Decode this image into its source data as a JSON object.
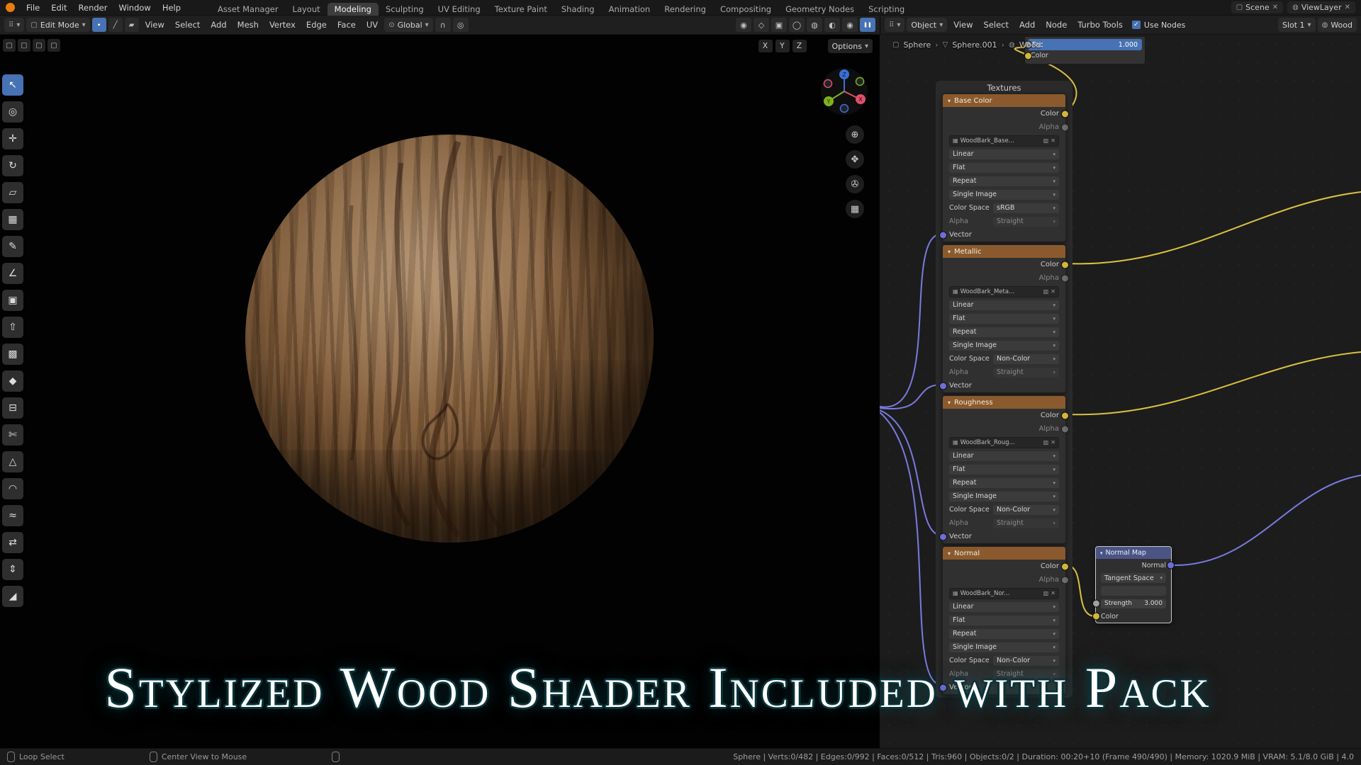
{
  "icons": {
    "chevron": "▾",
    "check": "✓",
    "close": "✕",
    "sep": "›",
    "editor_type": "⠿",
    "image": "▦",
    "fake_user": "▥",
    "zoom": "⊕",
    "pan": "✥",
    "camera": "✇",
    "grid_floor": "▦",
    "wireframe": "◯",
    "solid": "◍",
    "material_preview": "◐",
    "rendered": "◉",
    "pause": "❚❚",
    "globe": "⊙",
    "magnet": "∩",
    "proportional": "◎",
    "vertex_mode": "∙",
    "edge_mode": "╱",
    "face_mode": "▰",
    "cube": "▢",
    "mesh": "▽",
    "material": "◍",
    "widget": "▢",
    "visibility": "◉",
    "overlays": "◇",
    "xray": "▣"
  },
  "topbar": {
    "menus": [
      "File",
      "Edit",
      "Render",
      "Window",
      "Help"
    ],
    "workspaces": [
      "Asset Manager",
      "Layout",
      "Modeling",
      "Sculpting",
      "UV Editing",
      "Texture Paint",
      "Shading",
      "Animation",
      "Rendering",
      "Compositing",
      "Geometry Nodes",
      "Scripting"
    ],
    "active_workspace": "Modeling",
    "scene_label": "Scene",
    "viewlayer_label": "ViewLayer"
  },
  "viewport_header": {
    "mode_label": "Edit Mode",
    "menus": [
      "View",
      "Select",
      "Add",
      "Mesh",
      "Vertex",
      "Edge",
      "Face",
      "UV"
    ],
    "orientation_label": "Global",
    "axis_buttons": [
      "X",
      "Y",
      "Z"
    ],
    "options_label": "Options"
  },
  "node_header": {
    "shader_type_label": "Object",
    "menus": [
      "View",
      "Select",
      "Add",
      "Node",
      "Turbo Tools"
    ],
    "use_nodes_label": "Use Nodes",
    "slot_label": "Slot 1",
    "material_label": "Wood",
    "breadcrumb": [
      "Sphere",
      "Sphere.001",
      "Wood"
    ]
  },
  "viewport": {
    "gizmo_axes": [
      "X",
      "Y",
      "Z"
    ]
  },
  "toolbar": {
    "tools": [
      {
        "name": "tweak",
        "glyph": "↖"
      },
      {
        "name": "cursor",
        "glyph": "◎"
      },
      {
        "name": "move",
        "glyph": "✛"
      },
      {
        "name": "rotate",
        "glyph": "↻"
      },
      {
        "name": "scale",
        "glyph": "▱"
      },
      {
        "name": "transform",
        "glyph": "▦"
      },
      {
        "name": "annotate",
        "glyph": "✎"
      },
      {
        "name": "measure",
        "glyph": "∠"
      },
      {
        "name": "add-cube",
        "glyph": "▣"
      },
      {
        "name": "extrude-region",
        "glyph": "⇧"
      },
      {
        "name": "inset-faces",
        "glyph": "▩"
      },
      {
        "name": "bevel",
        "glyph": "◆"
      },
      {
        "name": "loop-cut",
        "glyph": "⊟"
      },
      {
        "name": "knife",
        "glyph": "✄"
      },
      {
        "name": "poly-build",
        "glyph": "△"
      },
      {
        "name": "spin",
        "glyph": "◠"
      },
      {
        "name": "smooth",
        "glyph": "≈"
      },
      {
        "name": "edge-slide",
        "glyph": "⇄"
      },
      {
        "name": "shrink-fatten",
        "glyph": "⇕"
      },
      {
        "name": "shear",
        "glyph": "◢"
      }
    ]
  },
  "node_editor": {
    "frame_label": "Textures",
    "fac_node": {
      "fac_label": "Fac",
      "fac_value": "1.000",
      "color_label": "Color"
    },
    "texture_nodes": [
      {
        "title": "Base Color",
        "color_label": "Color",
        "alpha_label": "Alpha",
        "image_name": "WoodBark_Base...",
        "interpolation": "Linear",
        "projection": "Flat",
        "extension": "Repeat",
        "source": "Single Image",
        "colorspace_label": "Color Space",
        "colorspace": "sRGB",
        "alpha_mode_label": "Alpha",
        "alpha_mode": "Straight",
        "vector_label": "Vector"
      },
      {
        "title": "Metallic",
        "color_label": "Color",
        "alpha_label": "Alpha",
        "image_name": "WoodBark_Meta...",
        "interpolation": "Linear",
        "projection": "Flat",
        "extension": "Repeat",
        "source": "Single Image",
        "colorspace_label": "Color Space",
        "colorspace": "Non-Color",
        "alpha_mode_label": "Alpha",
        "alpha_mode": "Straight",
        "vector_label": "Vector"
      },
      {
        "title": "Roughness",
        "color_label": "Color",
        "alpha_label": "Alpha",
        "image_name": "WoodBark_Roug...",
        "interpolation": "Linear",
        "projection": "Flat",
        "extension": "Repeat",
        "source": "Single Image",
        "colorspace_label": "Color Space",
        "colorspace": "Non-Color",
        "alpha_mode_label": "Alpha",
        "alpha_mode": "Straight",
        "vector_label": "Vector"
      },
      {
        "title": "Normal",
        "color_label": "Color",
        "alpha_label": "Alpha",
        "image_name": "WoodBark_Nor...",
        "interpolation": "Linear",
        "projection": "Flat",
        "extension": "Repeat",
        "source": "Single Image",
        "colorspace_label": "Color Space",
        "colorspace": "Non-Color",
        "alpha_mode_label": "Alpha",
        "alpha_mode": "Straight",
        "vector_label": "Vector"
      }
    ],
    "normal_map_node": {
      "title": "Normal Map",
      "normal_label": "Normal",
      "space": "Tangent Space",
      "strength_label": "Strength",
      "strength_value": "3.000",
      "color_label": "Color"
    }
  },
  "overlay": {
    "title": "Stylized Wood Shader Included with Pack"
  },
  "statusbar": {
    "left": "Loop Select",
    "middle": "Center View to Mouse",
    "right": "Sphere | Verts:0/482 | Edges:0/992 | Faces:0/512 | Tris:960 | Objects:0/2 | Duration: 00:20+10 (Frame 490/490) | Memory: 1020.9 MiB | VRAM: 5.1/8.0 GiB | 4.0"
  }
}
